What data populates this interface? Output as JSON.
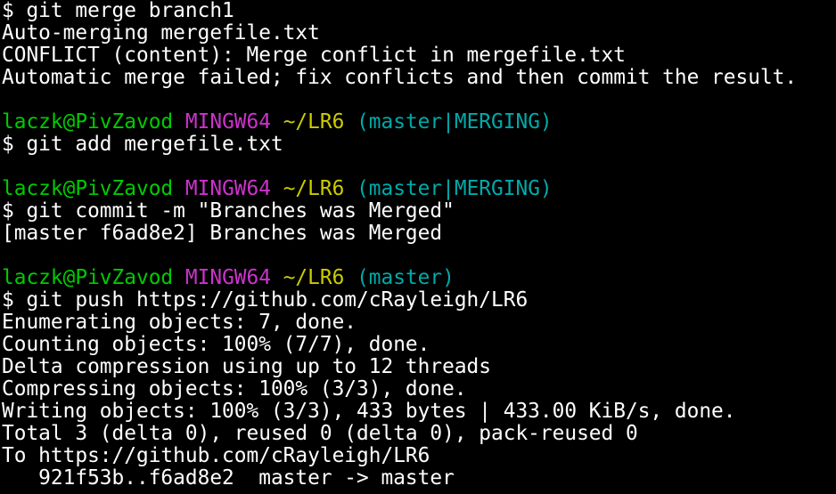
{
  "colors": {
    "background": "#000000",
    "text": "#ffffff",
    "user_host": "#00cc00",
    "msystem": "#cc33cc",
    "path": "#cccc00",
    "branch": "#00aaaa"
  },
  "terminal": {
    "lines": [
      {
        "segments": [
          {
            "text": "$ git merge branch1",
            "color": "#ffffff"
          }
        ]
      },
      {
        "segments": [
          {
            "text": "Auto-merging mergefile.txt",
            "color": "#ffffff"
          }
        ]
      },
      {
        "segments": [
          {
            "text": "CONFLICT (content): Merge conflict in mergefile.txt",
            "color": "#ffffff"
          }
        ]
      },
      {
        "segments": [
          {
            "text": "Automatic merge failed; fix conflicts and then commit the result.",
            "color": "#ffffff"
          }
        ]
      },
      {
        "segments": [
          {
            "text": "",
            "color": "#ffffff"
          }
        ]
      },
      {
        "segments": [
          {
            "text": "laczk@PivZavod",
            "color": "#00cc00"
          },
          {
            "text": " ",
            "color": "#ffffff"
          },
          {
            "text": "MINGW64",
            "color": "#cc33cc"
          },
          {
            "text": " ",
            "color": "#ffffff"
          },
          {
            "text": "~/LR6",
            "color": "#cccc00"
          },
          {
            "text": " ",
            "color": "#ffffff"
          },
          {
            "text": "(master|MERGING)",
            "color": "#00aaaa"
          }
        ]
      },
      {
        "segments": [
          {
            "text": "$ git add mergefile.txt",
            "color": "#ffffff"
          }
        ]
      },
      {
        "segments": [
          {
            "text": "",
            "color": "#ffffff"
          }
        ]
      },
      {
        "segments": [
          {
            "text": "laczk@PivZavod",
            "color": "#00cc00"
          },
          {
            "text": " ",
            "color": "#ffffff"
          },
          {
            "text": "MINGW64",
            "color": "#cc33cc"
          },
          {
            "text": " ",
            "color": "#ffffff"
          },
          {
            "text": "~/LR6",
            "color": "#cccc00"
          },
          {
            "text": " ",
            "color": "#ffffff"
          },
          {
            "text": "(master|MERGING)",
            "color": "#00aaaa"
          }
        ]
      },
      {
        "segments": [
          {
            "text": "$ git commit -m \"Branches was Merged\"",
            "color": "#ffffff"
          }
        ]
      },
      {
        "segments": [
          {
            "text": "[master f6ad8e2] Branches was Merged",
            "color": "#ffffff"
          }
        ]
      },
      {
        "segments": [
          {
            "text": "",
            "color": "#ffffff"
          }
        ]
      },
      {
        "segments": [
          {
            "text": "laczk@PivZavod",
            "color": "#00cc00"
          },
          {
            "text": " ",
            "color": "#ffffff"
          },
          {
            "text": "MINGW64",
            "color": "#cc33cc"
          },
          {
            "text": " ",
            "color": "#ffffff"
          },
          {
            "text": "~/LR6",
            "color": "#cccc00"
          },
          {
            "text": " ",
            "color": "#ffffff"
          },
          {
            "text": "(master)",
            "color": "#00aaaa"
          }
        ]
      },
      {
        "segments": [
          {
            "text": "$ git push https://github.com/cRayleigh/LR6",
            "color": "#ffffff"
          }
        ]
      },
      {
        "segments": [
          {
            "text": "Enumerating objects: 7, done.",
            "color": "#ffffff"
          }
        ]
      },
      {
        "segments": [
          {
            "text": "Counting objects: 100% (7/7), done.",
            "color": "#ffffff"
          }
        ]
      },
      {
        "segments": [
          {
            "text": "Delta compression using up to 12 threads",
            "color": "#ffffff"
          }
        ]
      },
      {
        "segments": [
          {
            "text": "Compressing objects: 100% (3/3), done.",
            "color": "#ffffff"
          }
        ]
      },
      {
        "segments": [
          {
            "text": "Writing objects: 100% (3/3), 433 bytes | 433.00 KiB/s, done.",
            "color": "#ffffff"
          }
        ]
      },
      {
        "segments": [
          {
            "text": "Total 3 (delta 0), reused 0 (delta 0), pack-reused 0",
            "color": "#ffffff"
          }
        ]
      },
      {
        "segments": [
          {
            "text": "To https://github.com/cRayleigh/LR6",
            "color": "#ffffff"
          }
        ]
      },
      {
        "segments": [
          {
            "text": "   921f53b..f6ad8e2  master -> master",
            "color": "#ffffff"
          }
        ]
      }
    ]
  }
}
